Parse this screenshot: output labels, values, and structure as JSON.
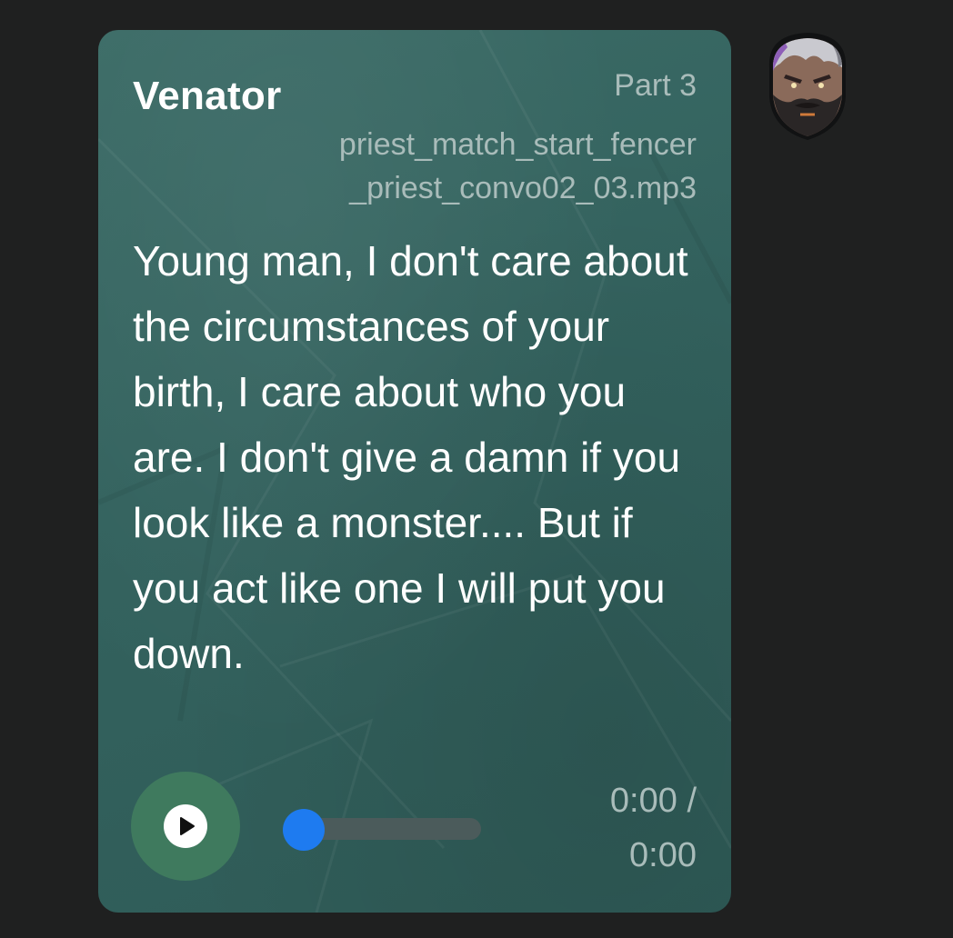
{
  "message": {
    "sender": "Venator",
    "part_label": "Part 3",
    "filename_line1": "priest_match_start_fencer",
    "filename_line2": "_priest_convo02_03.mp3",
    "text": "Young man, I don't care about the circumstances of your birth, I care about who you are. I don't give a damn if you look like a monster.... But if you act like one I will put you down."
  },
  "player": {
    "play_icon": "play-icon",
    "time_current": "0:00 /",
    "time_total": "0:00",
    "progress": 0
  },
  "avatar": {
    "icon": "bearded-warrior-avatar"
  },
  "colors": {
    "page_background": "#1f2020",
    "bubble": "#33625e",
    "play_button": "#3f7a5e",
    "knob": "#1e7bf0",
    "secondary_text": "#a9bcba"
  }
}
